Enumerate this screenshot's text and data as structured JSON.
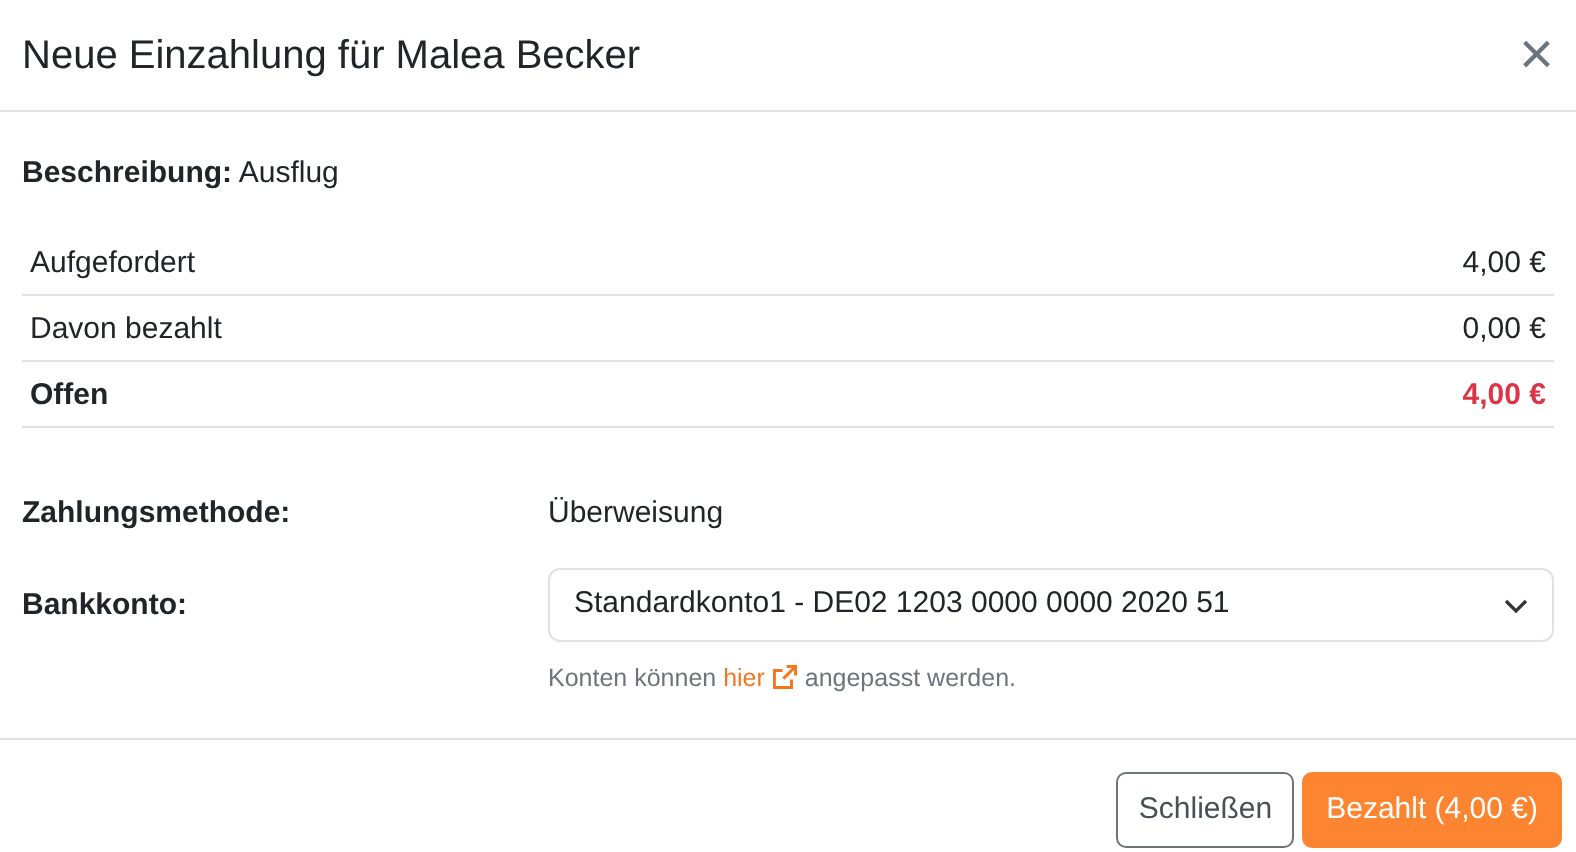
{
  "dialog": {
    "title": "Neue Einzahlung für Malea Becker",
    "close_icon": "×"
  },
  "description": {
    "label": "Beschreibung:",
    "value": "Ausflug"
  },
  "summary": [
    {
      "label": "Aufgefordert",
      "amount": "4,00 €",
      "kind": "normal"
    },
    {
      "label": "Davon bezahlt",
      "amount": "0,00 €",
      "kind": "normal"
    },
    {
      "label": "Offen",
      "amount": "4,00 €",
      "kind": "total"
    }
  ],
  "payment_method": {
    "label": "Zahlungsmethode:",
    "value": "Überweisung"
  },
  "bank_account": {
    "label": "Bankkonto:",
    "value": "Standardkonto1 - DE02 1203 0000 0000 2020 51",
    "hint_before": "Konten können ",
    "hint_link": "hier",
    "hint_after": " angepasst werden."
  },
  "buttons": [
    {
      "label": "Schließen",
      "kind": "secondary"
    },
    {
      "label": "Bezahlt (4,00 €)",
      "kind": "primary"
    }
  ]
}
